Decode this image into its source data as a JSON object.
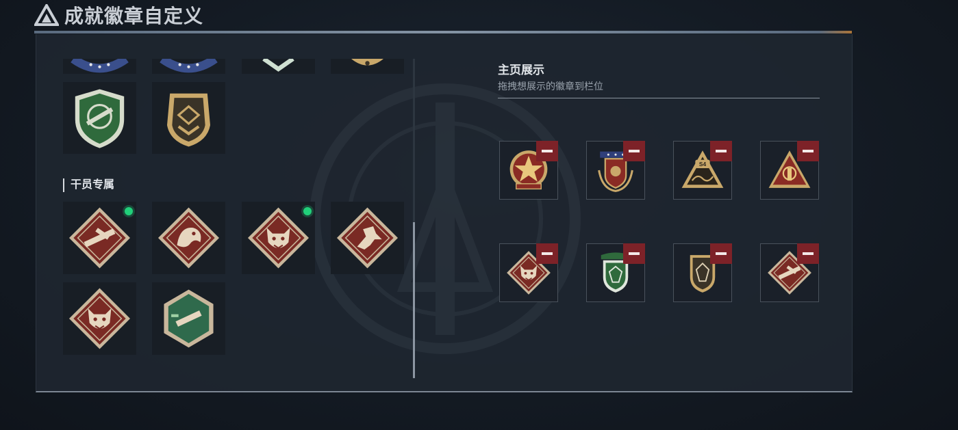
{
  "header": {
    "title": "成就徽章自定义",
    "logo_icon": "triangle-logo-icon"
  },
  "library": {
    "top_badges": [
      {
        "icon": "navy-wreath-badge-icon",
        "new": false
      },
      {
        "icon": "navy-wreath-badge-icon",
        "new": false
      },
      {
        "icon": "green-chevron-badge-icon",
        "new": false
      },
      {
        "icon": "gold-star-badge-icon",
        "new": false
      },
      {
        "icon": "green-rifle-shield-badge-icon",
        "new": false
      },
      {
        "icon": "gold-shield-badge-icon",
        "new": false
      }
    ],
    "operator_section": {
      "label": "干员专属",
      "badges": [
        {
          "icon": "red-diamond-weapon-badge-icon",
          "new": true
        },
        {
          "icon": "red-diamond-dragon-badge-icon",
          "new": false
        },
        {
          "icon": "red-diamond-wolf-badge-icon",
          "new": true
        },
        {
          "icon": "red-diamond-runner-badge-icon",
          "new": false
        },
        {
          "icon": "red-diamond-wolf-badge-icon",
          "new": false
        },
        {
          "icon": "green-hexagon-weapon-badge-icon",
          "new": false
        }
      ]
    }
  },
  "showcase": {
    "title": "主页展示",
    "subtitle": "拖拽想展示的徽章到栏位",
    "slots": [
      {
        "icon": "red-star-emblem-badge-icon"
      },
      {
        "icon": "red-laurel-shield-badge-icon"
      },
      {
        "icon": "gold-triangle-s4-badge-icon"
      },
      {
        "icon": "red-triangle-emblem-badge-icon"
      },
      {
        "icon": "red-diamond-wolf-badge-icon"
      },
      {
        "icon": "green-gem-shield-badge-icon"
      },
      {
        "icon": "gold-gem-shield-badge-icon"
      },
      {
        "icon": "red-diamond-weapon-badge-icon"
      }
    ],
    "remove_icon": "minus-icon"
  },
  "colors": {
    "new_dot": "#21d07a",
    "remove_button": "#7d2228",
    "badge_red": "#7a2a24",
    "badge_gold": "#c9a86a",
    "badge_green": "#2f6a3c"
  }
}
